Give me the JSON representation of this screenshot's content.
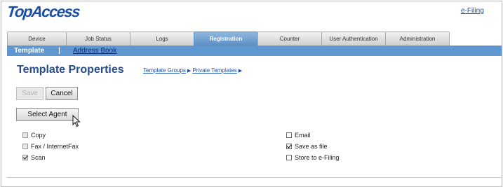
{
  "header": {
    "logo_text": "TopAccess",
    "efiling_link": "e-Filing"
  },
  "tabs": [
    {
      "label": "Device"
    },
    {
      "label": "Job Status"
    },
    {
      "label": "Logs"
    },
    {
      "label": "Registration",
      "active": true
    },
    {
      "label": "Counter"
    },
    {
      "label": "User Authentication"
    },
    {
      "label": "Administration"
    }
  ],
  "subnav": {
    "active": "Template",
    "separator": "|",
    "link": "Address Book"
  },
  "page": {
    "title": "Template Properties",
    "breadcrumb": [
      "Template Groups",
      "Private Templates"
    ]
  },
  "buttons": {
    "save": "Save",
    "cancel": "Cancel",
    "select_agent": "Select Agent"
  },
  "agents": {
    "copy": {
      "label": "Copy",
      "checked": false,
      "disabled": true
    },
    "fax": {
      "label": "Fax / InternetFax",
      "checked": false,
      "disabled": true
    },
    "scan": {
      "label": "Scan",
      "checked": true,
      "disabled": true
    },
    "email": {
      "label": "Email",
      "checked": false
    },
    "save_as_file": {
      "label": "Save as file",
      "checked": true
    },
    "store_efiling": {
      "label": "Store to e-Filing",
      "checked": false
    }
  },
  "colors": {
    "brand": "#1c4fa8",
    "active_tab": "#5d8fc4",
    "subnav": "#5f97d0",
    "title": "#244c8a"
  }
}
